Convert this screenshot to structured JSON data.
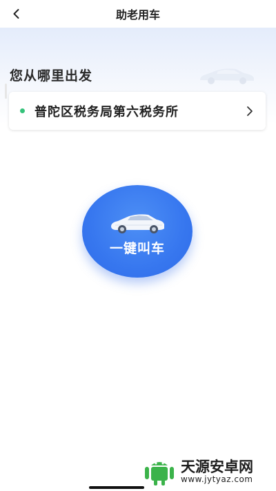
{
  "header": {
    "title": "助老用车",
    "back_icon": "chevron-left-icon"
  },
  "hero": {
    "headline": "您从哪里出发",
    "decor_icon": "car-icon"
  },
  "origin": {
    "address": "普陀区税务局第六税务所",
    "dot_color": "#35c27a",
    "chevron_icon": "chevron-right-icon"
  },
  "call_button": {
    "label": "一键叫车",
    "color": "#3777ef",
    "icon": "car-icon"
  },
  "watermark": {
    "brand": "天源安卓网",
    "url": "www.jytyaz.com",
    "logo_icon": "android-logo-icon"
  }
}
